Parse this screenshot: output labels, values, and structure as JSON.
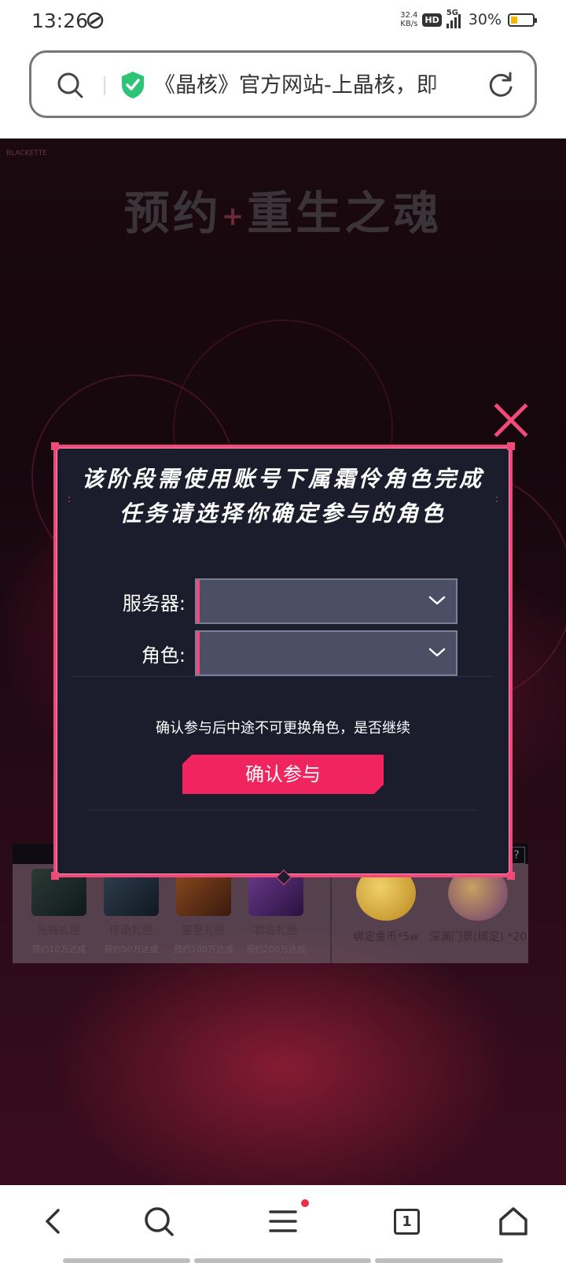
{
  "status": {
    "time": "13:26",
    "net_speed_value": "32.4",
    "net_speed_unit": "KB/s",
    "hd": "HD",
    "network": "5G",
    "battery": "30%",
    "battery_level": 0.3
  },
  "address_bar": {
    "page_title": "《晶核》官方网站-上晶核，即"
  },
  "banner": {
    "brand": "BLACKETTE",
    "title_left": "预约",
    "title_plus": "+",
    "title_right": "重生之魂"
  },
  "modal": {
    "title_line1": "该阶段需使用账号下属霜伶角色完成",
    "title_line2": "任务请选择你确定参与的角色",
    "server_label": "服务器:",
    "server_value": "",
    "role_label": "角色:",
    "role_value": "",
    "warning": "确认参与后中途不可更换角色，是否继续",
    "confirm_button": "确认参与",
    "colors": {
      "accent": "#ef4a7a",
      "button": "#f0245e",
      "panel": "#1b1d2c",
      "select": "#4b4f66"
    }
  },
  "rewards": {
    "help": "?",
    "gifts": [
      {
        "name": "先锋礼匣",
        "condition": "预约10万达成"
      },
      {
        "name": "传承礼匣",
        "condition": "预约50万达成"
      },
      {
        "name": "鎏星礼匣",
        "condition": "预约100万达成"
      },
      {
        "name": "君临礼匣",
        "condition": "预约200万达成"
      }
    ],
    "items": [
      {
        "name": "绑定金币*5w"
      },
      {
        "name": "深渊门票(绑定) *20"
      }
    ]
  },
  "bottom_nav": {
    "tab_count": "1"
  }
}
